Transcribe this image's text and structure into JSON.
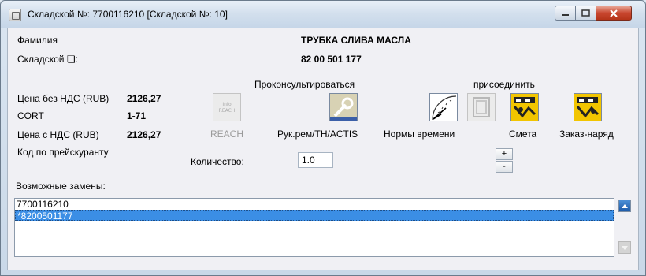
{
  "window": {
    "title": "Складской №: 7700116210 [Складской №: 10]"
  },
  "part": {
    "family_label": "Фамилия",
    "family_value": "ТРУБКА СЛИВА МАСЛА",
    "stock_label": "Складской ❏:",
    "stock_value": "82 00 501 177"
  },
  "prices": {
    "net_label": "Цена без НДС (RUB)",
    "net_value": "2126,27",
    "cort_label": "CORT",
    "cort_value": "1-71",
    "gross_label": "Цена с НДС (RUB)",
    "gross_value": "2126,27",
    "code_label": "Код по прейскуранту"
  },
  "sections": {
    "consult": "Проконсультироваться",
    "attach": "присоединить"
  },
  "actions": {
    "reach_label": "REACH",
    "reach_icon_text": "Info REACH",
    "manual_label": "Рук.рем/TH/ACTIS",
    "times_label": "Нормы времени",
    "estimate_label": "Смета",
    "order_label": "Заказ-наряд"
  },
  "quantity": {
    "label": "Количество:",
    "value": "1.0",
    "plus": "+",
    "minus": "-"
  },
  "replacements": {
    "label": "Возможные замены:",
    "items": [
      "7700116210",
      "*8200501177"
    ],
    "selected_index": 1
  },
  "colors": {
    "accent": "#3b8ee5",
    "close_button": "#c8462f"
  }
}
